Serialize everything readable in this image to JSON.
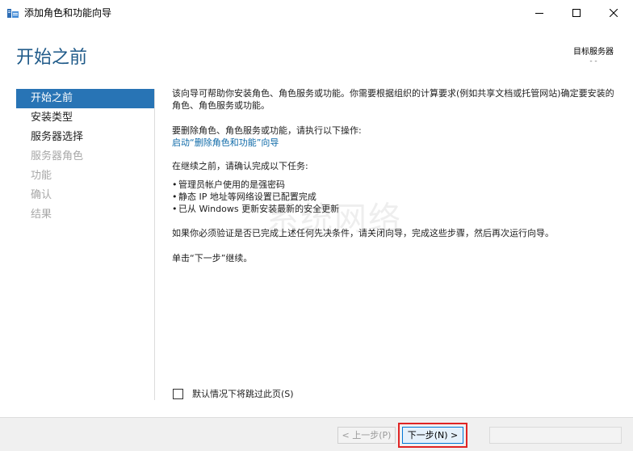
{
  "window": {
    "title": "添加角色和功能向导"
  },
  "header": {
    "page_title": "开始之前",
    "server_label": "目标服务器",
    "server_value": "- -"
  },
  "sidebar": {
    "items": [
      {
        "label": "开始之前",
        "state": "active"
      },
      {
        "label": "安装类型",
        "state": "enabled"
      },
      {
        "label": "服务器选择",
        "state": "enabled"
      },
      {
        "label": "服务器角色",
        "state": "disabled"
      },
      {
        "label": "功能",
        "state": "disabled"
      },
      {
        "label": "确认",
        "state": "disabled"
      },
      {
        "label": "结果",
        "state": "disabled"
      }
    ]
  },
  "content": {
    "intro": "该向导可帮助你安装角色、角色服务或功能。你需要根据组织的计算要求(例如共享文档或托管网站)确定要安装的角色、角色服务或功能。",
    "remove_prompt": "要删除角色、角色服务或功能，请执行以下操作:",
    "remove_link": "启动“删除角色和功能”向导",
    "tasks_intro": "在继续之前，请确认完成以下任务:",
    "tasks": [
      "管理员帐户使用的是强密码",
      "静态 IP 地址等网络设置已配置完成",
      "已从 Windows 更新安装最新的安全更新"
    ],
    "verify_note": "如果你必须验证是否已完成上述任何先决条件，请关闭向导，完成这些步骤，然后再次运行向导。",
    "continue_note": "单击“下一步”继续。"
  },
  "watermark": "系统网络",
  "skip": {
    "label": "默认情况下将跳过此页(S)",
    "checked": false
  },
  "footer": {
    "prev_label": "< 上一步(P)",
    "next_label": "下一步(N) >",
    "highlight_color": "#e02424"
  },
  "colors": {
    "accent": "#2874b5",
    "title": "#1f5a89",
    "link": "#0e6aa8"
  }
}
